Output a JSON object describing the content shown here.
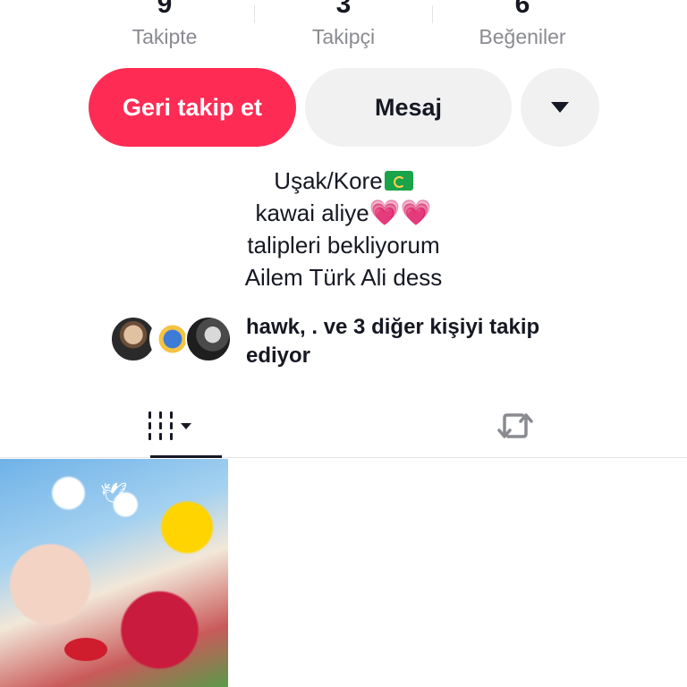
{
  "stats": [
    {
      "value": "9",
      "label": "Takipte"
    },
    {
      "value": "3",
      "label": "Takipçi"
    },
    {
      "value": "6",
      "label": "Beğeniler"
    }
  ],
  "actions": {
    "follow_back_label": "Geri takip et",
    "message_label": "Mesaj",
    "more_icon": "triangle-down-icon"
  },
  "bio": {
    "line1": "Uşak/Kore",
    "line1_emoji": "green-flag",
    "line2": "kawai aliye",
    "line2_emoji": "💗💗",
    "line3": "talipleri bekliyorum",
    "line4": "Ailem Türk Ali dess"
  },
  "followed_by": {
    "text": "hawk, . ve 3 diğer kişiyi takip ediyor"
  },
  "tabs": [
    {
      "name": "videos-grid",
      "icon": "grid-icon"
    },
    {
      "name": "reposts",
      "icon": "repost-icon"
    }
  ],
  "colors": {
    "accent": "#fe2c55",
    "button_gray": "#f1f1f2",
    "text_primary": "#161823",
    "text_secondary": "#8a8b91"
  }
}
